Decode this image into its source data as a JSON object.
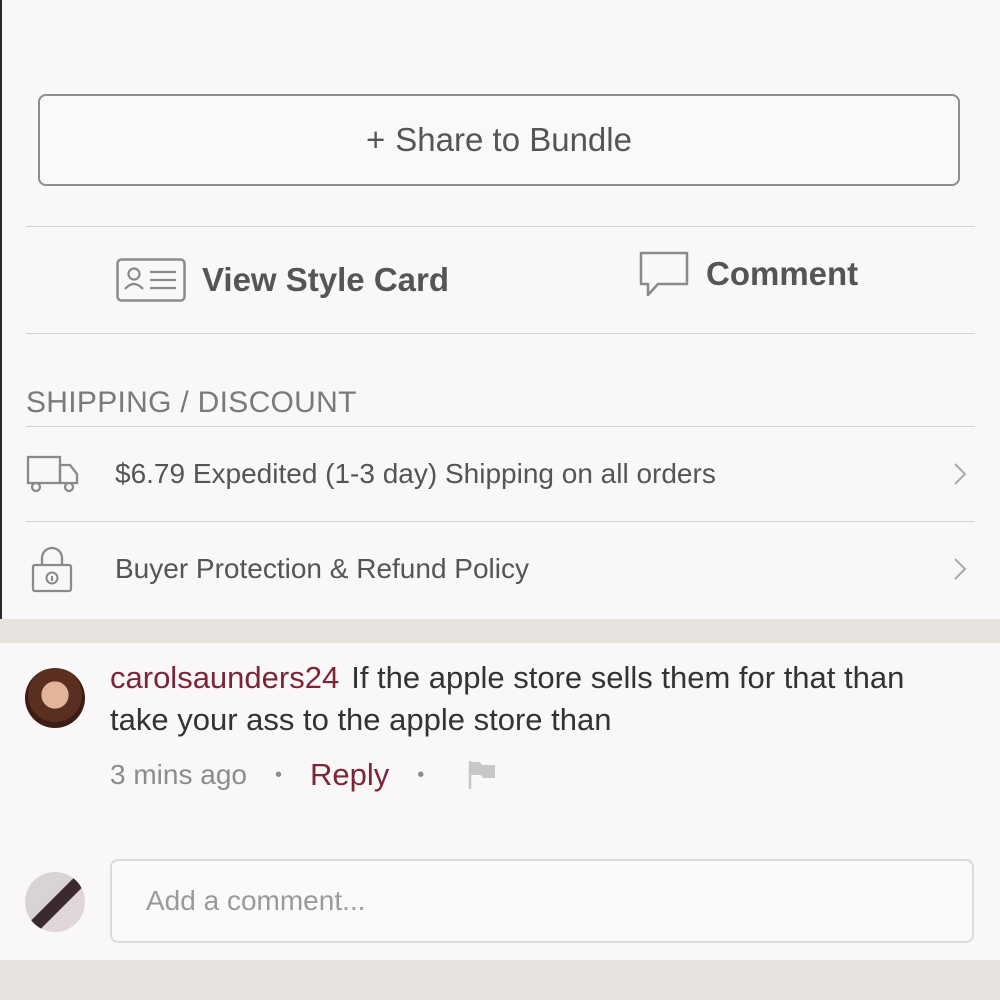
{
  "share_button": {
    "plus": "+",
    "label": "Share to Bundle"
  },
  "actions": {
    "style_card": {
      "label": "View Style Card",
      "icon": "id-card-icon"
    },
    "comment": {
      "label": "Comment",
      "icon": "speech-bubble-icon"
    }
  },
  "shipping": {
    "title": "SHIPPING / DISCOUNT",
    "rows": [
      {
        "icon": "truck-icon",
        "label": "$6.79 Expedited (1-3 day) Shipping on all orders"
      },
      {
        "icon": "lock-icon",
        "label": "Buyer Protection & Refund Policy"
      }
    ]
  },
  "comment": {
    "username": "carolsaunders24",
    "text": "If the apple store sells them for that than take your ass to the apple store than",
    "time": "3 mins ago",
    "separator": "•",
    "reply_label": "Reply",
    "flag_icon": "flag-icon"
  },
  "comment_input": {
    "placeholder": "Add a comment..."
  },
  "colors": {
    "accent": "#7b2536",
    "divider": "#d4d2d2",
    "band": "#e7e4df"
  }
}
